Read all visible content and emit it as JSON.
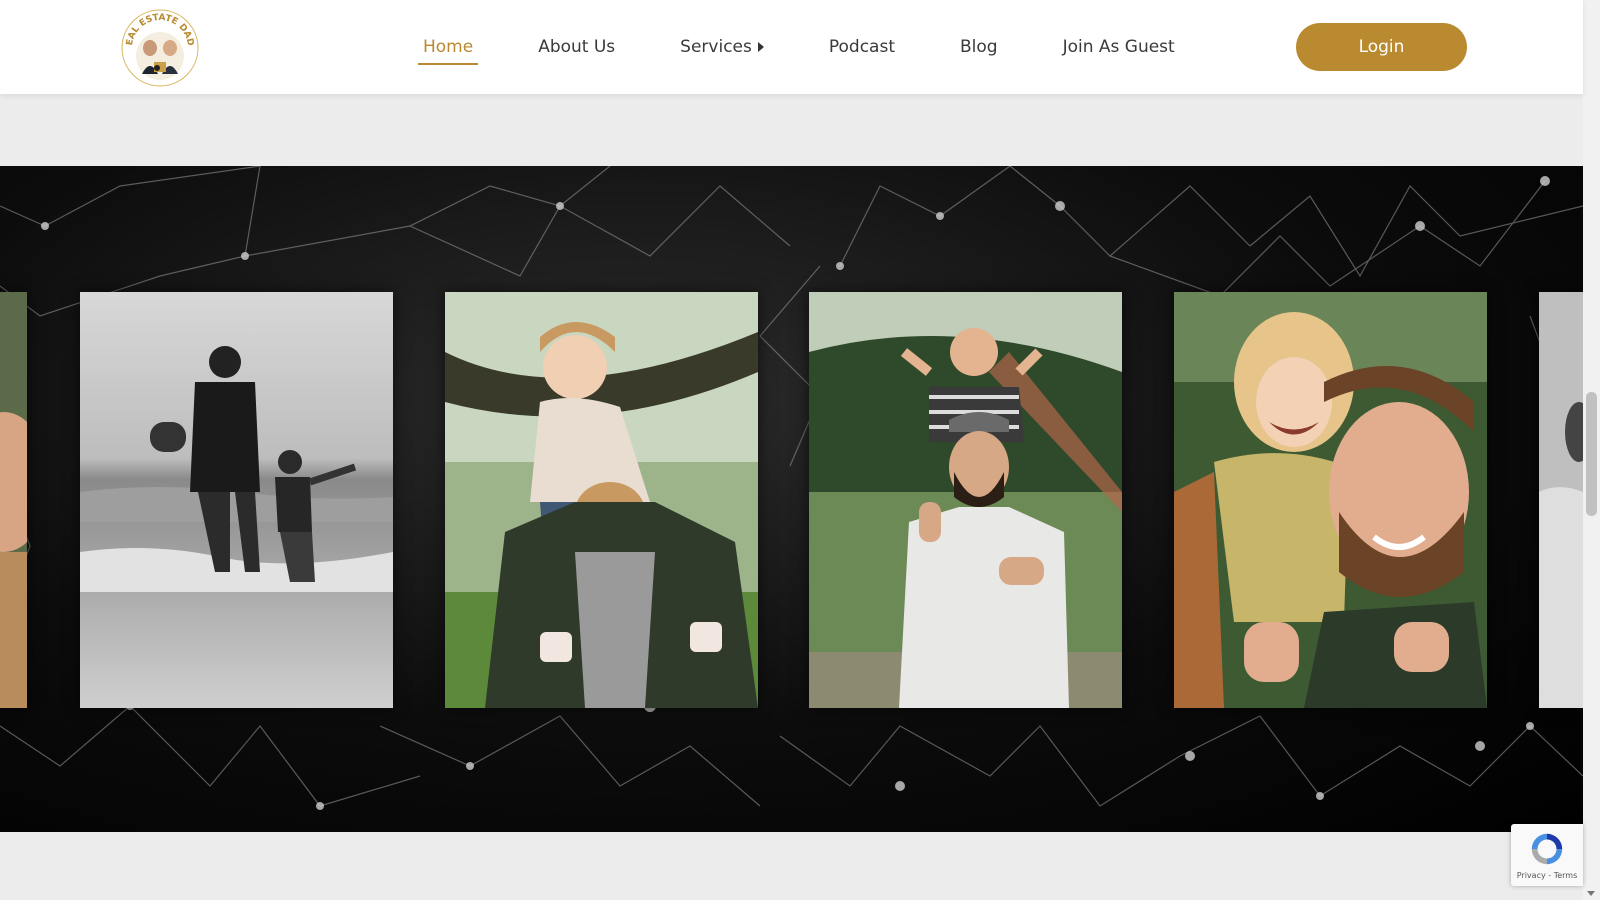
{
  "header": {
    "logo_alt": "Real Estate Dads",
    "nav": [
      {
        "label": "Home",
        "active": true
      },
      {
        "label": "About Us"
      },
      {
        "label": "Services",
        "has_submenu": true
      },
      {
        "label": "Podcast"
      },
      {
        "label": "Blog"
      },
      {
        "label": "Join As Guest"
      }
    ],
    "login_label": "Login"
  },
  "gallery": {
    "photos": [
      {
        "desc": "partial photo at left edge"
      },
      {
        "desc": "black-and-white photo of father and son in the sea"
      },
      {
        "desc": "girl riding on father's shoulders in park"
      },
      {
        "desc": "boy on bearded father's shoulders giving thumbs up"
      },
      {
        "desc": "curly-haired toddler on smiling father's shoulders"
      },
      {
        "desc": "partial photo at right edge"
      }
    ]
  },
  "recaptcha": {
    "privacy": "Privacy",
    "separator": " - ",
    "terms": "Terms"
  },
  "colors": {
    "accent": "#b98a2f",
    "header_bg": "#ffffff",
    "page_bg": "#ececec",
    "gallery_bg": "#000000"
  }
}
